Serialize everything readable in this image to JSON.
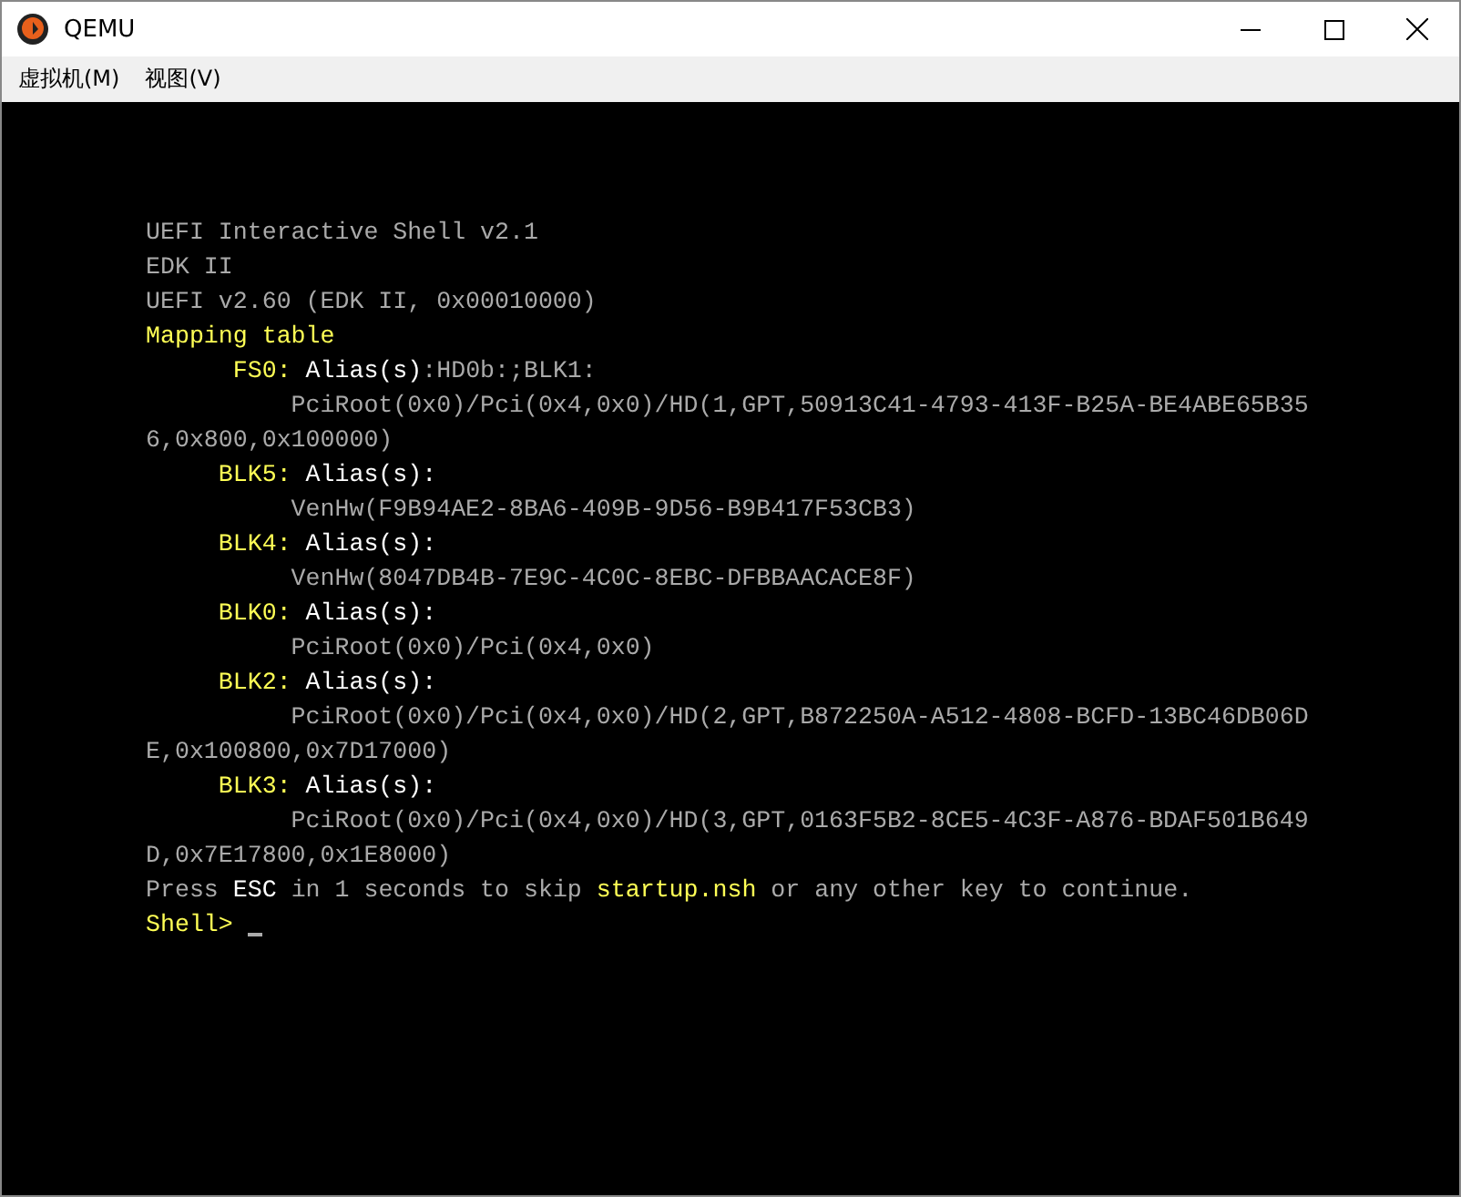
{
  "window": {
    "title": "QEMU"
  },
  "menu": [
    {
      "label": "虚拟机(M)"
    },
    {
      "label": "视图(V)"
    }
  ],
  "console": {
    "lines": [
      [
        {
          "text": "UEFI Interactive Shell v2.1",
          "kind": "normal"
        }
      ],
      [
        {
          "text": "EDK II",
          "kind": "normal"
        }
      ],
      [
        {
          "text": "UEFI v2.60 (EDK II, 0x00010000)",
          "kind": "normal"
        }
      ],
      [
        {
          "text": "Mapping table",
          "kind": "yellow"
        }
      ],
      [
        {
          "text": "      FS0:",
          "kind": "yellow"
        },
        {
          "text": " Alias(s)",
          "kind": "bright"
        },
        {
          "text": ":HD0b:;BLK1:",
          "kind": "normal"
        }
      ],
      [
        {
          "text": "          PciRoot(0x0)/Pci(0x4,0x0)/HD(1,GPT,50913C41-4793-413F-B25A-BE4ABE65B35",
          "kind": "normal"
        }
      ],
      [
        {
          "text": "6,0x800,0x100000)",
          "kind": "normal"
        }
      ],
      [
        {
          "text": "     BLK5:",
          "kind": "yellow"
        },
        {
          "text": " Alias(s):",
          "kind": "bright"
        }
      ],
      [
        {
          "text": "          VenHw(F9B94AE2-8BA6-409B-9D56-B9B417F53CB3)",
          "kind": "normal"
        }
      ],
      [
        {
          "text": "     BLK4:",
          "kind": "yellow"
        },
        {
          "text": " Alias(s):",
          "kind": "bright"
        }
      ],
      [
        {
          "text": "          VenHw(8047DB4B-7E9C-4C0C-8EBC-DFBBAACACE8F)",
          "kind": "normal"
        }
      ],
      [
        {
          "text": "     BLK0:",
          "kind": "yellow"
        },
        {
          "text": " Alias(s):",
          "kind": "bright"
        }
      ],
      [
        {
          "text": "          PciRoot(0x0)/Pci(0x4,0x0)",
          "kind": "normal"
        }
      ],
      [
        {
          "text": "     BLK2:",
          "kind": "yellow"
        },
        {
          "text": " Alias(s):",
          "kind": "bright"
        }
      ],
      [
        {
          "text": "          PciRoot(0x0)/Pci(0x4,0x0)/HD(2,GPT,B872250A-A512-4808-BCFD-13BC46DB06D",
          "kind": "normal"
        }
      ],
      [
        {
          "text": "E,0x100800,0x7D17000)",
          "kind": "normal"
        }
      ],
      [
        {
          "text": "     BLK3:",
          "kind": "yellow"
        },
        {
          "text": " Alias(s):",
          "kind": "bright"
        }
      ],
      [
        {
          "text": "          PciRoot(0x0)/Pci(0x4,0x0)/HD(3,GPT,0163F5B2-8CE5-4C3F-A876-BDAF501B649",
          "kind": "normal"
        }
      ],
      [
        {
          "text": "D,0x7E17800,0x1E8000)",
          "kind": "normal"
        }
      ],
      [
        {
          "text": "Press ",
          "kind": "normal"
        },
        {
          "text": "ESC",
          "kind": "bright"
        },
        {
          "text": " in 1 seconds to skip ",
          "kind": "normal"
        },
        {
          "text": "startup.nsh",
          "kind": "yellow"
        },
        {
          "text": " or any other key to continue.",
          "kind": "normal"
        }
      ],
      [
        {
          "text": "Shell> ",
          "kind": "yellow"
        }
      ]
    ],
    "cursor": true
  }
}
